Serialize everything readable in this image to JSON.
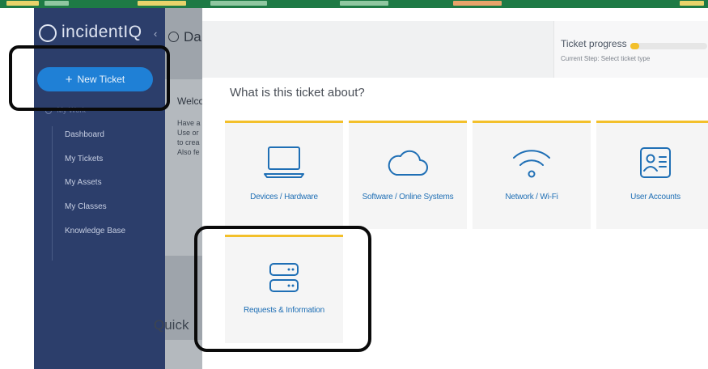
{
  "app": {
    "brand_name": "incidentIQ",
    "dashboard_title": "Da"
  },
  "sidebar": {
    "new_ticket_label": "New Ticket",
    "section_label": "My Work",
    "items": [
      {
        "label": "Dashboard"
      },
      {
        "label": "My Tickets"
      },
      {
        "label": "My Assets"
      },
      {
        "label": "My Classes"
      },
      {
        "label": "Knowledge Base"
      }
    ]
  },
  "background": {
    "welcome_title": "Welco",
    "welcome_lines": [
      "Have a",
      "Use or",
      "to crea",
      "Also fe"
    ],
    "quick_title": "Quick"
  },
  "modal": {
    "progress_label": "Ticket progress",
    "progress_fraction": 0.12,
    "current_step": "Current Step: Select ticket type",
    "question": "What is this ticket about?",
    "categories": [
      {
        "label": "Devices / Hardware",
        "icon": "laptop-icon"
      },
      {
        "label": "Software / Online Systems",
        "icon": "cloud-icon"
      },
      {
        "label": "Network / Wi-Fi",
        "icon": "wifi-icon"
      },
      {
        "label": "User Accounts",
        "icon": "id-card-icon"
      },
      {
        "label": "Requests & Information",
        "icon": "server-icon"
      }
    ]
  },
  "colors": {
    "sidebar": "#2c3e6b",
    "accent_blue": "#1f80d6",
    "card_accent": "#f3c02b",
    "icon_blue": "#1f6fb5"
  }
}
